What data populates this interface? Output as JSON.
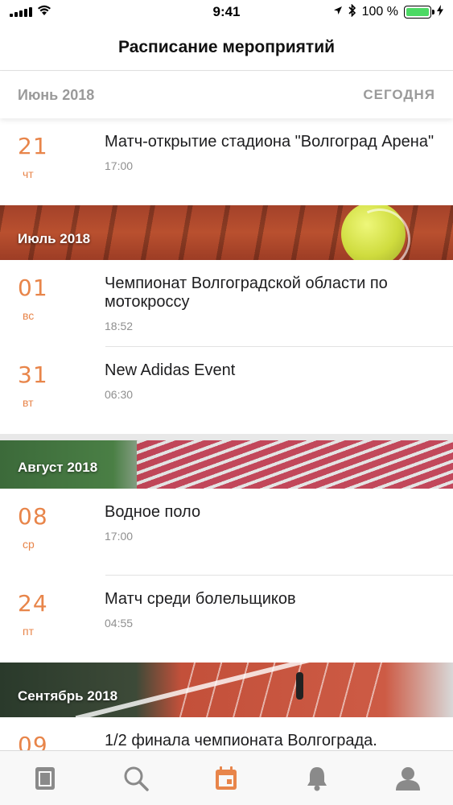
{
  "status_bar": {
    "time": "9:41",
    "battery_percent": "100 %",
    "battery_level": 1.0,
    "icons": [
      "signal-icon",
      "wifi-icon",
      "location-arrow-icon",
      "bluetooth-icon",
      "battery-icon",
      "charging-icon"
    ]
  },
  "header": {
    "title": "Расписание мероприятий"
  },
  "month_bar": {
    "month": "Июнь 2018",
    "today_label": "СЕГОДНЯ"
  },
  "events_june": [
    {
      "day": "21",
      "weekday": "чт",
      "title": "Матч-открытие стадиона \"Волгоград Арена\"",
      "time": "17:00"
    }
  ],
  "banner_july": {
    "label": "Июль 2018"
  },
  "events_july": [
    {
      "day": "01",
      "weekday": "вс",
      "title": "Чемпионат Волгоградской области по мотокроссу",
      "time": "18:52"
    },
    {
      "day": "31",
      "weekday": "вт",
      "title": "New Adidas Event",
      "time": "06:30"
    }
  ],
  "banner_august": {
    "label": "Август 2018"
  },
  "events_august": [
    {
      "day": "08",
      "weekday": "ср",
      "title": "Водное поло",
      "time": "17:00"
    },
    {
      "day": "24",
      "weekday": "пт",
      "title": "Матч среди болельщиков",
      "time": "04:55"
    }
  ],
  "banner_september": {
    "label": "Сентябрь 2018"
  },
  "events_september": [
    {
      "day": "09",
      "weekday": "",
      "title": "1/2 финала чемпионата Волгограда.",
      "time": ""
    }
  ],
  "tab_bar": {
    "active_color": "#e8854a",
    "inactive_color": "#8a8a8a",
    "tabs": [
      "news-icon",
      "search-icon",
      "calendar-icon",
      "bell-icon",
      "profile-icon"
    ],
    "active_index": 2
  },
  "colors": {
    "accent": "#e8854a",
    "muted_text": "#9a9a9a"
  }
}
